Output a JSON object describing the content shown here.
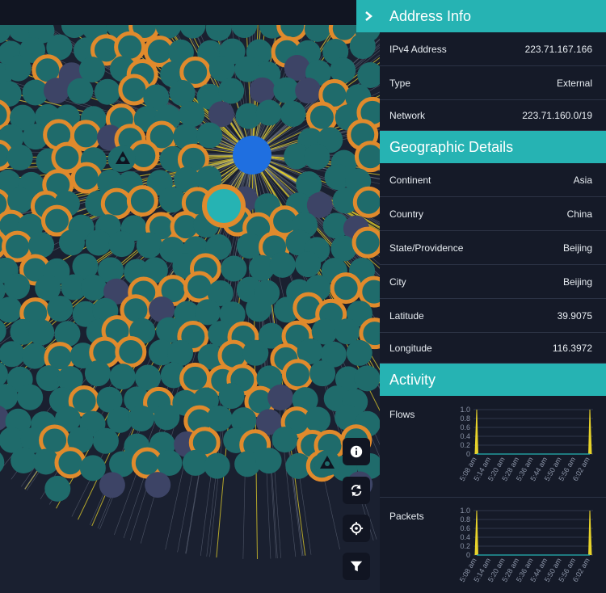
{
  "panel": {
    "header_title": "Address Info",
    "address_rows": [
      {
        "key": "IPv4 Address",
        "value": "223.71.167.166"
      },
      {
        "key": "Type",
        "value": "External"
      },
      {
        "key": "Network",
        "value": "223.71.160.0/19"
      }
    ],
    "geo_title": "Geographic Details",
    "geo_rows": [
      {
        "key": "Continent",
        "value": "Asia"
      },
      {
        "key": "Country",
        "value": "China"
      },
      {
        "key": "State/Providence",
        "value": "Beijing"
      },
      {
        "key": "City",
        "value": "Beijing"
      },
      {
        "key": "Latitude",
        "value": "39.9075"
      },
      {
        "key": "Longitude",
        "value": "116.3972"
      }
    ],
    "activity_title": "Activity"
  },
  "chart_data": [
    {
      "type": "line",
      "title": "Flows",
      "y_ticks": [
        "1.0",
        "0.8",
        "0.6",
        "0.4",
        "0.2",
        "0"
      ],
      "x_ticks": [
        "5:08 am",
        "5:14 am",
        "5:20 am",
        "5:28 am",
        "5:36 am",
        "5:44 am",
        "5:50 am",
        "5:56 am",
        "6:02 am"
      ],
      "ylim": [
        0,
        1
      ],
      "grid": true,
      "series": [
        {
          "values": [
            1,
            0,
            0,
            0,
            0,
            0,
            0,
            0,
            0,
            0,
            0,
            0,
            0,
            0,
            0,
            0,
            0,
            0,
            0,
            0,
            0,
            0,
            0,
            0,
            0,
            0,
            0,
            0,
            0,
            1
          ],
          "color": "#e8d32a"
        }
      ]
    },
    {
      "type": "line",
      "title": "Packets",
      "y_ticks": [
        "1.0",
        "0.8",
        "0.6",
        "0.4",
        "0.2",
        "0"
      ],
      "x_ticks": [
        "5:08 am",
        "5:14 am",
        "5:20 am",
        "5:28 am",
        "5:36 am",
        "5:44 am",
        "5:50 am",
        "5:56 am",
        "6:02 am"
      ],
      "ylim": [
        0,
        1
      ],
      "grid": true,
      "series": [
        {
          "values": [
            1,
            0,
            0,
            0,
            0,
            0,
            0,
            0,
            0,
            0,
            0,
            0,
            0,
            0,
            0,
            0,
            0,
            0,
            0,
            0,
            0,
            0,
            0,
            0,
            0,
            0,
            0,
            0,
            0,
            1
          ],
          "color": "#e8d32a"
        }
      ]
    }
  ],
  "tools": [
    {
      "icon": "info-icon"
    },
    {
      "icon": "refresh-icon"
    },
    {
      "icon": "crosshair-icon"
    },
    {
      "icon": "filter-icon"
    }
  ],
  "colors": {
    "accent": "#26b3b3",
    "node_fill": "#1f6b6b",
    "node_ring": "#e08a2c",
    "center_node": "#1f6fe0",
    "edge_yellow": "#e8d32a",
    "edge_grey": "#8a93a6"
  }
}
